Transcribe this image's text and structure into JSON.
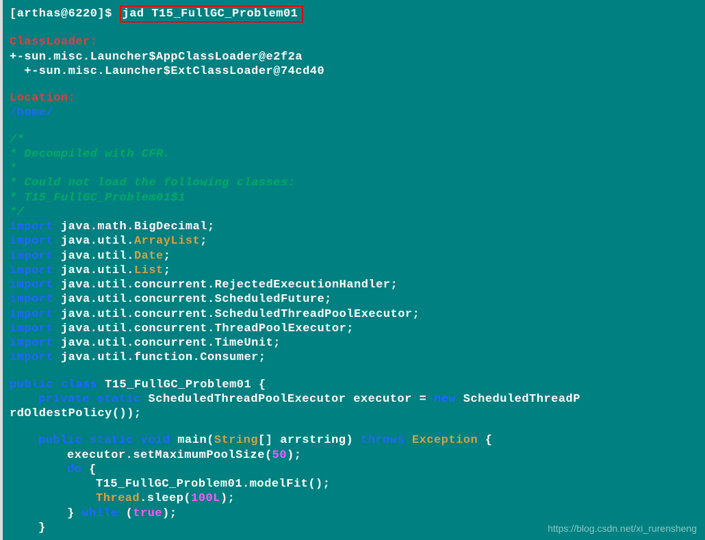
{
  "prompt": {
    "prefix": "[arthas@6220]$ ",
    "command": "jad T15_FullGC_Problem01"
  },
  "classloader": {
    "header": "ClassLoader:",
    "line1": "+-sun.misc.Launcher$AppClassLoader@e2f2a",
    "line2": "  +-sun.misc.Launcher$ExtClassLoader@74cd40"
  },
  "location": {
    "header": "Location:",
    "path": "/home/"
  },
  "comment": {
    "l1": "/*",
    "l2": " * Decompiled with CFR.",
    "l3": " * ",
    "l4": " * Could not load the following classes:",
    "l5": " *  T15_FullGC_Problem01$1",
    "l6": " */"
  },
  "imports": {
    "kw": "import",
    "pkg1a": " java.math.BigDecimal;",
    "pkg2a": " java.util.",
    "pkg2b": "ArrayList",
    "semi": ";",
    "pkg3a": " java.util.",
    "pkg3b": "Date",
    "pkg4a": " java.util.",
    "pkg4b": "List",
    "pkg5a": " java.util.concurrent.RejectedExecutionHandler;",
    "pkg6a": " java.util.concurrent.ScheduledFuture;",
    "pkg7a": " java.util.concurrent.ScheduledThreadPoolExecutor;",
    "pkg8a": " java.util.concurrent.ThreadPoolExecutor;",
    "pkg9a": " java.util.concurrent.TimeUnit;",
    "pkg10a": " java.util.function.Consumer;"
  },
  "classdecl": {
    "public": "public",
    "class": "class",
    "name": " T15_FullGC_Problem01 {",
    "private": "private",
    "static": "static",
    "fieldtype": " ScheduledThreadPoolExecutor executor = ",
    "new": "new",
    "fieldrest": " ScheduledThreadP",
    "line2": "rdOldestPolicy());"
  },
  "main": {
    "public": "public",
    "static": "static",
    "void": "void",
    "method": " main(",
    "string": "String",
    "args": "[] arrstring) ",
    "throws": "throws",
    "exc": "Exception",
    "brace": " {",
    "line1a": "executor.setMaximumPoolSize(",
    "line1num": "50",
    "line1b": ");",
    "do": "do",
    "dobrace": " {",
    "fit": "T15_FullGC_Problem01.modelFit();",
    "thread": "Thread",
    "sleep": ".sleep(",
    "sleepnum": "100L",
    "sleepend": ");",
    "closebrace": "} ",
    "while": "while",
    "cond1": " (",
    "true": "true",
    "cond2": ");",
    "methodclose": "}"
  },
  "watermark": "https://blog.csdn.net/xi_rurensheng"
}
